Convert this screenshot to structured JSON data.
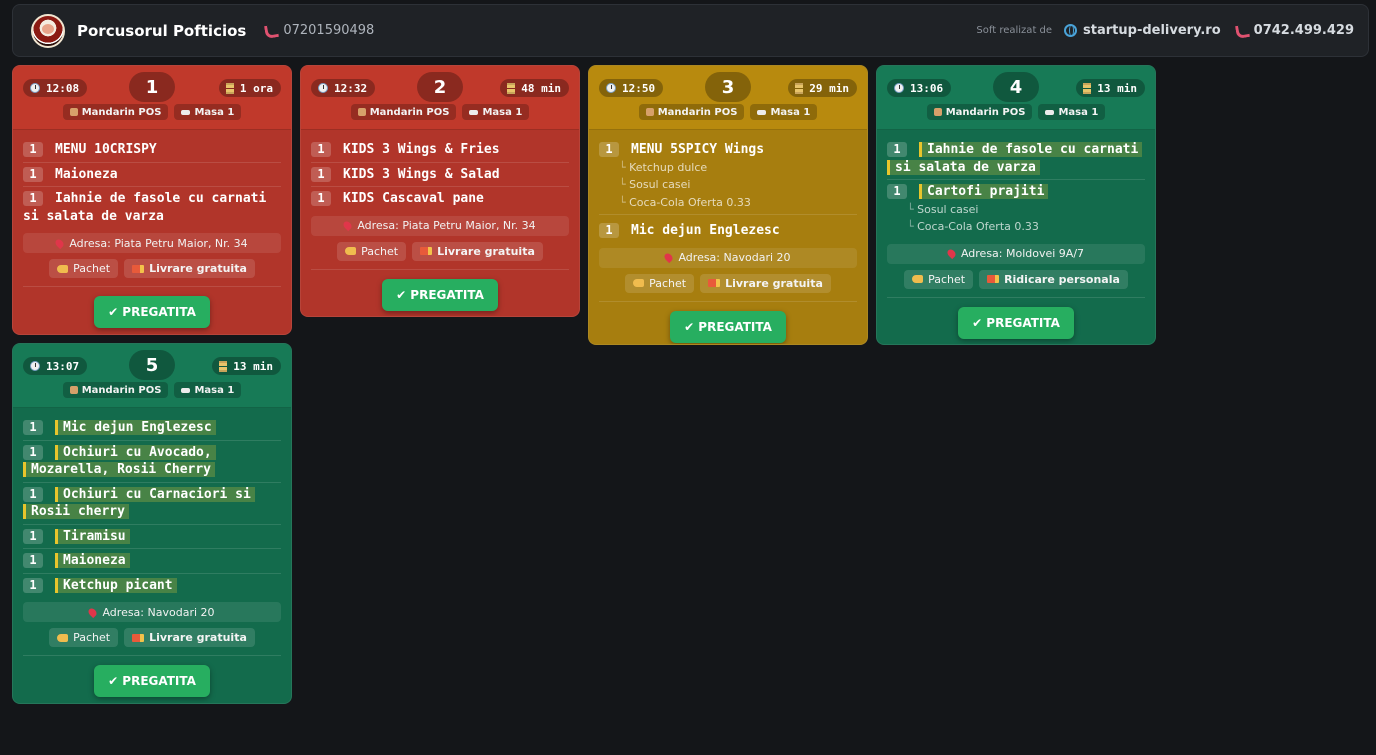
{
  "header": {
    "brand": "Porcusorul Pofticios",
    "phone": "07201590498",
    "soft_label": "Soft realizat de",
    "site": "startup-delivery.ro",
    "support_phone": "0742.499.429"
  },
  "cards": [
    {
      "color": "#c0392b",
      "time": "12:08",
      "number": "1",
      "waited": "1 ora",
      "pos": "Mandarin POS",
      "table": "Masa 1",
      "items": [
        {
          "qty": "1",
          "name": "MENU 10CRISPY"
        },
        {
          "qty": "1",
          "name": "Maioneza"
        },
        {
          "qty": "1",
          "name": "Iahnie de fasole cu carnati si salata de varza"
        }
      ],
      "address": "Adresa: Piata Petru Maior, Nr. 34",
      "tag1": "Pachet",
      "tag2": "Livrare gratuita",
      "button": "✔ PREGATITA"
    },
    {
      "color": "#c0392b",
      "time": "12:32",
      "number": "2",
      "waited": "48 min",
      "pos": "Mandarin POS",
      "table": "Masa 1",
      "items": [
        {
          "qty": "1",
          "name": "KIDS 3 Wings & Fries"
        },
        {
          "qty": "1",
          "name": "KIDS 3 Wings & Salad"
        },
        {
          "qty": "1",
          "name": "KIDS Cascaval pane"
        }
      ],
      "address": "Adresa: Piata Petru Maior, Nr. 34",
      "tag1": "Pachet",
      "tag2": "Livrare gratuita",
      "button": "✔ PREGATITA"
    },
    {
      "color": "#b88a0e",
      "time": "12:50",
      "number": "3",
      "waited": "29 min",
      "pos": "Mandarin POS",
      "table": "Masa 1",
      "items": [
        {
          "qty": "1",
          "name": "MENU 5SPICY Wings",
          "mods": [
            "Ketchup dulce",
            "Sosul casei",
            "Coca-Cola Oferta 0.33"
          ]
        },
        {
          "qty": "1",
          "name": "Mic dejun Englezesc"
        }
      ],
      "address": "Adresa: Navodari 20",
      "tag1": "Pachet",
      "tag2": "Livrare gratuita",
      "button": "✔ PREGATITA"
    },
    {
      "color": "#177a56",
      "time": "13:06",
      "number": "4",
      "waited": "13 min",
      "pos": "Mandarin POS",
      "table": "Masa 1",
      "items": [
        {
          "qty": "1",
          "name": "Iahnie de fasole cu carnati si salata de varza"
        },
        {
          "qty": "1",
          "name": "Cartofi prajiti",
          "mods": [
            "Sosul casei",
            "Coca-Cola Oferta 0.33"
          ]
        }
      ],
      "address": "Adresa: Moldovei 9A/7",
      "tag1": "Pachet",
      "tag2": "Ridicare personala",
      "button": "✔ PREGATITA"
    },
    {
      "color": "#177a56",
      "time": "13:07",
      "number": "5",
      "waited": "13 min",
      "pos": "Mandarin POS",
      "table": "Masa 1",
      "items": [
        {
          "qty": "1",
          "name": "Mic dejun Englezesc"
        },
        {
          "qty": "1",
          "name": "Ochiuri cu Avocado, Mozarella, Rosii Cherry"
        },
        {
          "qty": "1",
          "name": "Ochiuri cu Carnaciori si Rosii cherry"
        },
        {
          "qty": "1",
          "name": "Tiramisu"
        },
        {
          "qty": "1",
          "name": "Maioneza"
        },
        {
          "qty": "1",
          "name": "Ketchup picant"
        }
      ],
      "address": "Adresa: Navodari 20",
      "tag1": "Pachet",
      "tag2": "Livrare gratuita",
      "button": "✔ PREGATITA"
    }
  ]
}
